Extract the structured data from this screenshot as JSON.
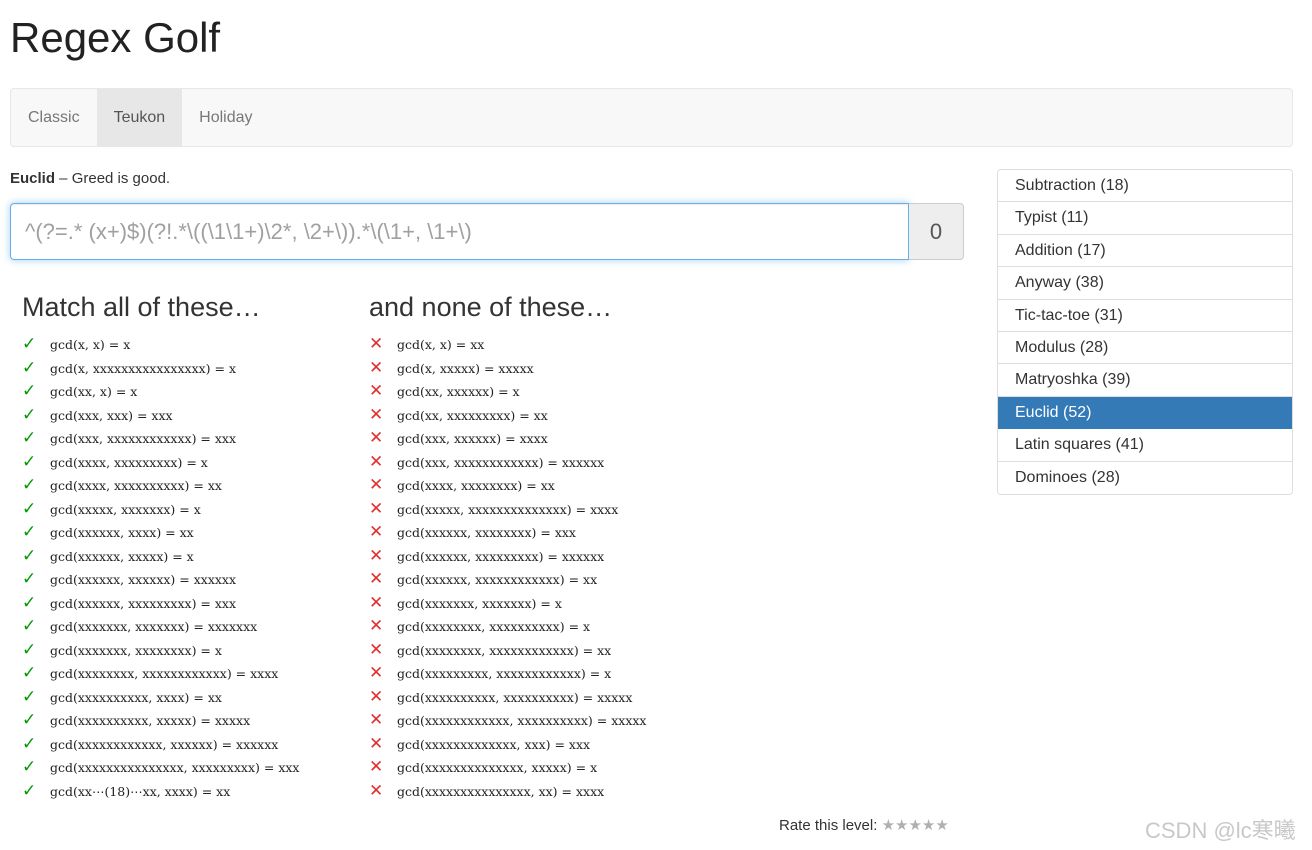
{
  "app": {
    "title": "Regex Golf"
  },
  "nav": {
    "tabs": [
      {
        "label": "Classic",
        "active": false
      },
      {
        "label": "Teukon",
        "active": true
      },
      {
        "label": "Holiday",
        "active": false
      }
    ]
  },
  "puzzle": {
    "name": "Euclid",
    "separator": " – ",
    "tagline": "Greed is good."
  },
  "regex": {
    "placeholder": "^(?=.* (x+)$)(?!.*\\((\\1\\1+)\\2*, \\2+\\)).*\\(\\1+, \\1+\\)",
    "score": "0"
  },
  "match": {
    "heading": "Match all of these…",
    "items": [
      "gcd(x, x) = x",
      "gcd(x, xxxxxxxxxxxxxxxx) = x",
      "gcd(xx, x) = x",
      "gcd(xxx, xxx) = xxx",
      "gcd(xxx, xxxxxxxxxxxx) = xxx",
      "gcd(xxxx, xxxxxxxxx) = x",
      "gcd(xxxx, xxxxxxxxxx) = xx",
      "gcd(xxxxx, xxxxxxx) = x",
      "gcd(xxxxxx, xxxx) = xx",
      "gcd(xxxxxx, xxxxx) = x",
      "gcd(xxxxxx, xxxxxx) = xxxxxx",
      "gcd(xxxxxx, xxxxxxxxx) = xxx",
      "gcd(xxxxxxx, xxxxxxx) = xxxxxxx",
      "gcd(xxxxxxx, xxxxxxxx) = x",
      "gcd(xxxxxxxx, xxxxxxxxxxxx) = xxxx",
      "gcd(xxxxxxxxxx, xxxx) = xx",
      "gcd(xxxxxxxxxx, xxxxx) = xxxxx",
      "gcd(xxxxxxxxxxxx, xxxxxx) = xxxxxx",
      "gcd(xxxxxxxxxxxxxxx, xxxxxxxxx) = xxx",
      "gcd(xx⋯(18)⋯xx, xxxx) = xx"
    ]
  },
  "nomatch": {
    "heading": "and none of these…",
    "items": [
      "gcd(x, x) = xx",
      "gcd(x, xxxxx) = xxxxx",
      "gcd(xx, xxxxxx) = x",
      "gcd(xx, xxxxxxxxx) = xx",
      "gcd(xxx, xxxxxx) = xxxx",
      "gcd(xxx, xxxxxxxxxxxx) = xxxxxx",
      "gcd(xxxx, xxxxxxxx) = xx",
      "gcd(xxxxx, xxxxxxxxxxxxxx) = xxxx",
      "gcd(xxxxxx, xxxxxxxx) = xxx",
      "gcd(xxxxxx, xxxxxxxxx) = xxxxxx",
      "gcd(xxxxxx, xxxxxxxxxxxx) = xx",
      "gcd(xxxxxxx, xxxxxxx) = x",
      "gcd(xxxxxxxx, xxxxxxxxxx) = x",
      "gcd(xxxxxxxx, xxxxxxxxxxxx) = xx",
      "gcd(xxxxxxxxx, xxxxxxxxxxxx) = x",
      "gcd(xxxxxxxxxx, xxxxxxxxxx) = xxxxx",
      "gcd(xxxxxxxxxxxx, xxxxxxxxxx) = xxxxx",
      "gcd(xxxxxxxxxxxxx, xxx) = xxx",
      "gcd(xxxxxxxxxxxxxx, xxxxx) = x",
      "gcd(xxxxxxxxxxxxxxx, xx) = xxxx"
    ]
  },
  "sidebar": {
    "levels": [
      {
        "label": "Subtraction (18)",
        "active": false
      },
      {
        "label": "Typist (11)",
        "active": false
      },
      {
        "label": "Addition (17)",
        "active": false
      },
      {
        "label": "Anyway (38)",
        "active": false
      },
      {
        "label": "Tic-tac-toe (31)",
        "active": false
      },
      {
        "label": "Modulus (28)",
        "active": false
      },
      {
        "label": "Matryoshka (39)",
        "active": false
      },
      {
        "label": "Euclid (52)",
        "active": true
      },
      {
        "label": "Latin squares (41)",
        "active": false
      },
      {
        "label": "Dominoes (28)",
        "active": false
      }
    ]
  },
  "rating": {
    "label": "Rate this level:",
    "stars": "★★★★★"
  },
  "icons": {
    "check": "check-icon",
    "cross": "cross-icon",
    "star": "star-icon"
  },
  "colors": {
    "accent": "#337ab7",
    "check": "#009900",
    "cross": "#e03030"
  },
  "watermark": "CSDN @lc寒曦"
}
